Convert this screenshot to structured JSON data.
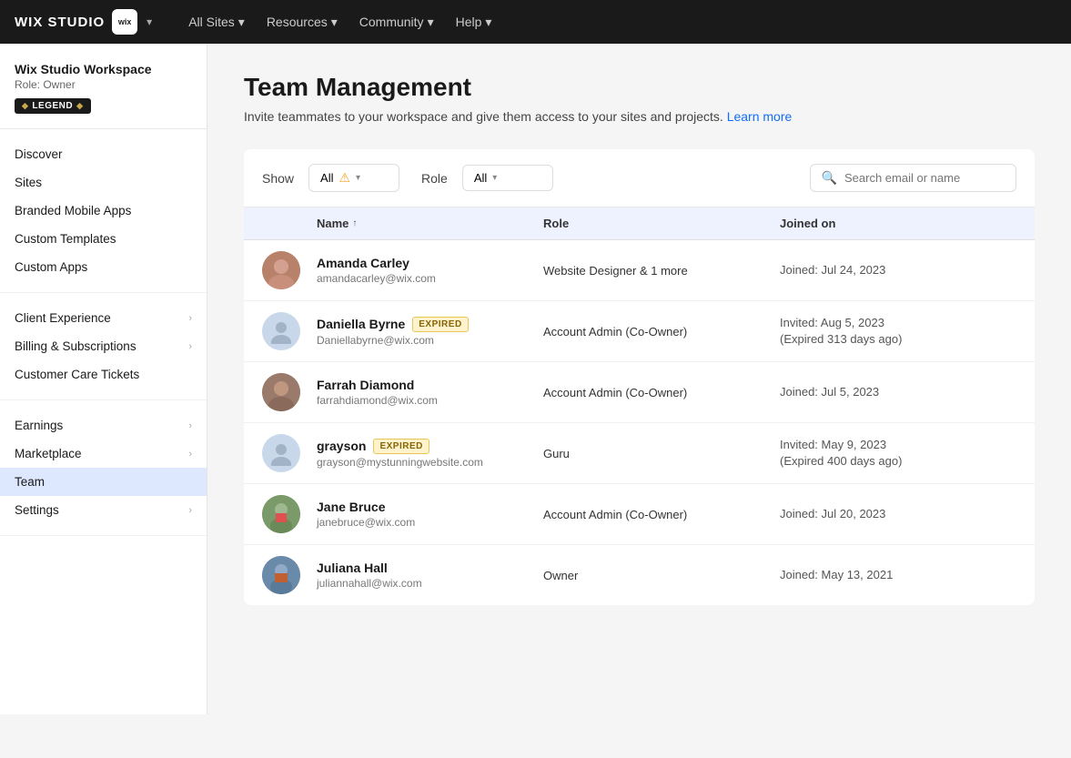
{
  "topnav": {
    "logo_text": "WIX STUDIO",
    "logo_badge": "wix",
    "links": [
      {
        "label": "All Sites",
        "has_chevron": true
      },
      {
        "label": "Resources",
        "has_chevron": true
      },
      {
        "label": "Community",
        "has_chevron": true
      },
      {
        "label": "Help",
        "has_chevron": true
      }
    ]
  },
  "sidebar": {
    "workspace_name": "Wix Studio Workspace",
    "workspace_role": "Role: Owner",
    "legend_badge": "LEGEND",
    "items": [
      {
        "id": "discover",
        "label": "Discover",
        "has_chevron": false,
        "active": false
      },
      {
        "id": "sites",
        "label": "Sites",
        "has_chevron": false,
        "active": false
      },
      {
        "id": "branded-mobile-apps",
        "label": "Branded Mobile Apps",
        "has_chevron": false,
        "active": false
      },
      {
        "id": "custom-templates",
        "label": "Custom Templates",
        "has_chevron": false,
        "active": false
      },
      {
        "id": "custom-apps",
        "label": "Custom Apps",
        "has_chevron": false,
        "active": false
      },
      {
        "id": "client-experience",
        "label": "Client Experience",
        "has_chevron": true,
        "active": false
      },
      {
        "id": "billing-subscriptions",
        "label": "Billing & Subscriptions",
        "has_chevron": true,
        "active": false
      },
      {
        "id": "customer-care-tickets",
        "label": "Customer Care Tickets",
        "has_chevron": false,
        "active": false
      },
      {
        "id": "earnings",
        "label": "Earnings",
        "has_chevron": true,
        "active": false
      },
      {
        "id": "marketplace",
        "label": "Marketplace",
        "has_chevron": true,
        "active": false
      },
      {
        "id": "team",
        "label": "Team",
        "has_chevron": false,
        "active": true
      },
      {
        "id": "settings",
        "label": "Settings",
        "has_chevron": true,
        "active": false
      }
    ]
  },
  "page": {
    "title": "Team Management",
    "subtitle": "Invite teammates to your workspace and give them access to your sites and projects.",
    "learn_more": "Learn more"
  },
  "filters": {
    "show_label": "Show",
    "show_value": "All",
    "role_label": "Role",
    "role_value": "All",
    "search_placeholder": "Search email or name"
  },
  "table": {
    "columns": [
      "",
      "Name",
      "Role",
      "Joined on"
    ],
    "members": [
      {
        "id": 1,
        "name": "Amanda Carley",
        "email": "amandacarley@wix.com",
        "role": "Website Designer & 1 more",
        "joined": "Joined: Jul 24, 2023",
        "expired": false,
        "avatar_type": "photo",
        "avatar_color": "#c8a090"
      },
      {
        "id": 2,
        "name": "Daniella Byrne",
        "email": "Daniellabyrne@wix.com",
        "role": "Account Admin (Co-Owner)",
        "joined": "Invited: Aug 5, 2023\n(Expired 313 days ago)",
        "joined_line1": "Invited: Aug 5, 2023",
        "joined_line2": "(Expired 313 days ago)",
        "expired": true,
        "avatar_type": "placeholder"
      },
      {
        "id": 3,
        "name": "Farrah Diamond",
        "email": "farrahdiamond@wix.com",
        "role": "Account Admin (Co-Owner)",
        "joined": "Joined: Jul 5, 2023",
        "expired": false,
        "avatar_type": "photo",
        "avatar_color": "#8b6b5a"
      },
      {
        "id": 4,
        "name": "grayson",
        "email": "grayson@mystunningwebsite.com",
        "role": "Guru",
        "joined": "Invited: May 9, 2023\n(Expired 400 days ago)",
        "joined_line1": "Invited: May 9, 2023",
        "joined_line2": "(Expired 400 days ago)",
        "expired": true,
        "avatar_type": "placeholder"
      },
      {
        "id": 5,
        "name": "Jane Bruce",
        "email": "janebruce@wix.com",
        "role": "Account Admin (Co-Owner)",
        "joined": "Joined: Jul 20, 2023",
        "expired": false,
        "avatar_type": "photo",
        "avatar_color": "#7a8c6a"
      },
      {
        "id": 6,
        "name": "Juliana Hall",
        "email": "juliannahall@wix.com",
        "role": "Owner",
        "joined": "Joined: May 13, 2021",
        "expired": false,
        "avatar_type": "photo",
        "avatar_color": "#5a7a9a"
      }
    ]
  },
  "badges": {
    "expired_label": "EXPIRED"
  }
}
